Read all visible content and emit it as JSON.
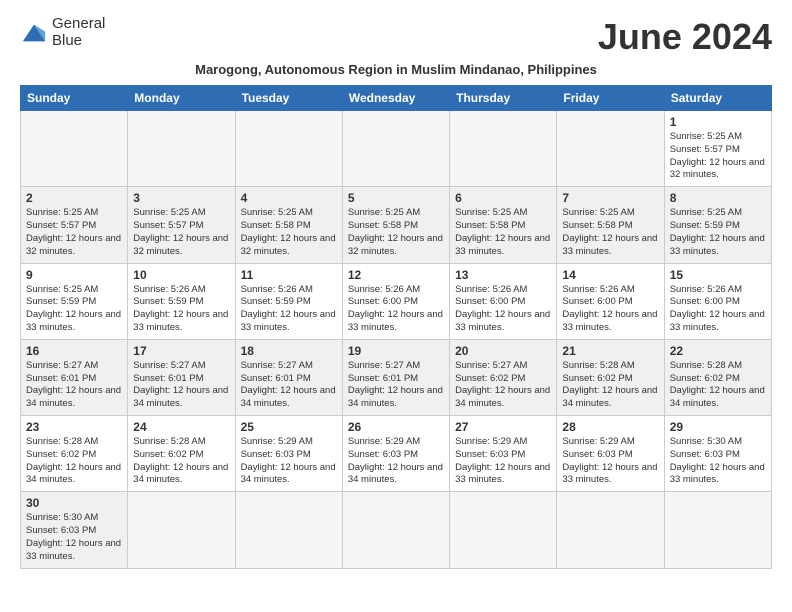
{
  "header": {
    "logo_line1": "General",
    "logo_line2": "Blue",
    "month_title": "June 2024",
    "subtitle": "Marogong, Autonomous Region in Muslim Mindanao, Philippines"
  },
  "weekdays": [
    "Sunday",
    "Monday",
    "Tuesday",
    "Wednesday",
    "Thursday",
    "Friday",
    "Saturday"
  ],
  "weeks": [
    [
      {
        "day": "",
        "info": ""
      },
      {
        "day": "",
        "info": ""
      },
      {
        "day": "",
        "info": ""
      },
      {
        "day": "",
        "info": ""
      },
      {
        "day": "",
        "info": ""
      },
      {
        "day": "",
        "info": ""
      },
      {
        "day": "1",
        "info": "Sunrise: 5:25 AM\nSunset: 5:57 PM\nDaylight: 12 hours and 32 minutes."
      }
    ],
    [
      {
        "day": "2",
        "info": "Sunrise: 5:25 AM\nSunset: 5:57 PM\nDaylight: 12 hours and 32 minutes."
      },
      {
        "day": "3",
        "info": "Sunrise: 5:25 AM\nSunset: 5:57 PM\nDaylight: 12 hours and 32 minutes."
      },
      {
        "day": "4",
        "info": "Sunrise: 5:25 AM\nSunset: 5:58 PM\nDaylight: 12 hours and 32 minutes."
      },
      {
        "day": "5",
        "info": "Sunrise: 5:25 AM\nSunset: 5:58 PM\nDaylight: 12 hours and 32 minutes."
      },
      {
        "day": "6",
        "info": "Sunrise: 5:25 AM\nSunset: 5:58 PM\nDaylight: 12 hours and 33 minutes."
      },
      {
        "day": "7",
        "info": "Sunrise: 5:25 AM\nSunset: 5:58 PM\nDaylight: 12 hours and 33 minutes."
      },
      {
        "day": "8",
        "info": "Sunrise: 5:25 AM\nSunset: 5:59 PM\nDaylight: 12 hours and 33 minutes."
      }
    ],
    [
      {
        "day": "9",
        "info": "Sunrise: 5:25 AM\nSunset: 5:59 PM\nDaylight: 12 hours and 33 minutes."
      },
      {
        "day": "10",
        "info": "Sunrise: 5:26 AM\nSunset: 5:59 PM\nDaylight: 12 hours and 33 minutes."
      },
      {
        "day": "11",
        "info": "Sunrise: 5:26 AM\nSunset: 5:59 PM\nDaylight: 12 hours and 33 minutes."
      },
      {
        "day": "12",
        "info": "Sunrise: 5:26 AM\nSunset: 6:00 PM\nDaylight: 12 hours and 33 minutes."
      },
      {
        "day": "13",
        "info": "Sunrise: 5:26 AM\nSunset: 6:00 PM\nDaylight: 12 hours and 33 minutes."
      },
      {
        "day": "14",
        "info": "Sunrise: 5:26 AM\nSunset: 6:00 PM\nDaylight: 12 hours and 33 minutes."
      },
      {
        "day": "15",
        "info": "Sunrise: 5:26 AM\nSunset: 6:00 PM\nDaylight: 12 hours and 33 minutes."
      }
    ],
    [
      {
        "day": "16",
        "info": "Sunrise: 5:27 AM\nSunset: 6:01 PM\nDaylight: 12 hours and 34 minutes."
      },
      {
        "day": "17",
        "info": "Sunrise: 5:27 AM\nSunset: 6:01 PM\nDaylight: 12 hours and 34 minutes."
      },
      {
        "day": "18",
        "info": "Sunrise: 5:27 AM\nSunset: 6:01 PM\nDaylight: 12 hours and 34 minutes."
      },
      {
        "day": "19",
        "info": "Sunrise: 5:27 AM\nSunset: 6:01 PM\nDaylight: 12 hours and 34 minutes."
      },
      {
        "day": "20",
        "info": "Sunrise: 5:27 AM\nSunset: 6:02 PM\nDaylight: 12 hours and 34 minutes."
      },
      {
        "day": "21",
        "info": "Sunrise: 5:28 AM\nSunset: 6:02 PM\nDaylight: 12 hours and 34 minutes."
      },
      {
        "day": "22",
        "info": "Sunrise: 5:28 AM\nSunset: 6:02 PM\nDaylight: 12 hours and 34 minutes."
      }
    ],
    [
      {
        "day": "23",
        "info": "Sunrise: 5:28 AM\nSunset: 6:02 PM\nDaylight: 12 hours and 34 minutes."
      },
      {
        "day": "24",
        "info": "Sunrise: 5:28 AM\nSunset: 6:02 PM\nDaylight: 12 hours and 34 minutes."
      },
      {
        "day": "25",
        "info": "Sunrise: 5:29 AM\nSunset: 6:03 PM\nDaylight: 12 hours and 34 minutes."
      },
      {
        "day": "26",
        "info": "Sunrise: 5:29 AM\nSunset: 6:03 PM\nDaylight: 12 hours and 34 minutes."
      },
      {
        "day": "27",
        "info": "Sunrise: 5:29 AM\nSunset: 6:03 PM\nDaylight: 12 hours and 33 minutes."
      },
      {
        "day": "28",
        "info": "Sunrise: 5:29 AM\nSunset: 6:03 PM\nDaylight: 12 hours and 33 minutes."
      },
      {
        "day": "29",
        "info": "Sunrise: 5:30 AM\nSunset: 6:03 PM\nDaylight: 12 hours and 33 minutes."
      }
    ],
    [
      {
        "day": "30",
        "info": "Sunrise: 5:30 AM\nSunset: 6:03 PM\nDaylight: 12 hours and 33 minutes."
      },
      {
        "day": "",
        "info": ""
      },
      {
        "day": "",
        "info": ""
      },
      {
        "day": "",
        "info": ""
      },
      {
        "day": "",
        "info": ""
      },
      {
        "day": "",
        "info": ""
      },
      {
        "day": "",
        "info": ""
      }
    ]
  ],
  "row_backgrounds": [
    "white",
    "gray",
    "white",
    "gray",
    "white",
    "gray"
  ]
}
